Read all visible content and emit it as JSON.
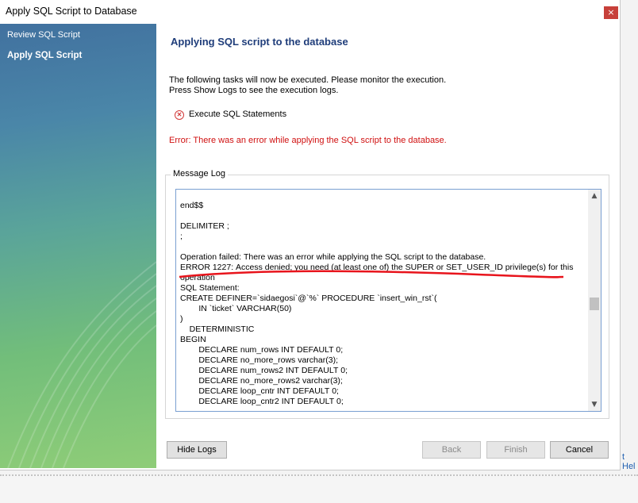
{
  "window": {
    "title": "Apply SQL Script to Database",
    "close_glyph": "×"
  },
  "sidebar": {
    "items": [
      {
        "label": "Review SQL Script",
        "active": false
      },
      {
        "label": "Apply SQL Script",
        "active": true
      }
    ]
  },
  "main": {
    "title": "Applying SQL script to the database",
    "description_line1": "The following tasks will now be executed. Please monitor the execution.",
    "description_line2": "Press Show Logs to see the execution logs.",
    "task": {
      "icon": "error-circle-icon",
      "label": "Execute SQL Statements"
    },
    "error": "Error: There was an error while applying the SQL script to the database."
  },
  "message_log": {
    "label": "Message Log",
    "lines": [
      "end$$",
      "",
      "DELIMITER ;",
      ";",
      "",
      "Operation failed: There was an error while applying the SQL script to the database.",
      "ERROR 1227: Access denied; you need (at least one of) the SUPER or SET_USER_ID privilege(s) for this",
      "operation",
      "SQL Statement:",
      "CREATE DEFINER=`sidaegosi`@`%` PROCEDURE `insert_win_rst`(",
      "        IN `ticket` VARCHAR(50)",
      ")",
      "    DETERMINISTIC",
      "BEGIN",
      "        DECLARE num_rows INT DEFAULT 0;",
      "        DECLARE no_more_rows varchar(3);",
      "        DECLARE num_rows2 INT DEFAULT 0;",
      "        DECLARE no_more_rows2 varchar(3);",
      "        DECLARE loop_cntr INT DEFAULT 0;",
      "        DECLARE loop_cntr2 INT DEFAULT 0;"
    ],
    "highlight_color": "#e8141c"
  },
  "buttons": {
    "hide_logs": "Hide Logs",
    "back": "Back",
    "finish": "Finish",
    "cancel": "Cancel"
  },
  "background": {
    "partial_link_text": "t Hel"
  },
  "colors": {
    "title_blue": "#1f3d7a",
    "error_red": "#d01010"
  }
}
